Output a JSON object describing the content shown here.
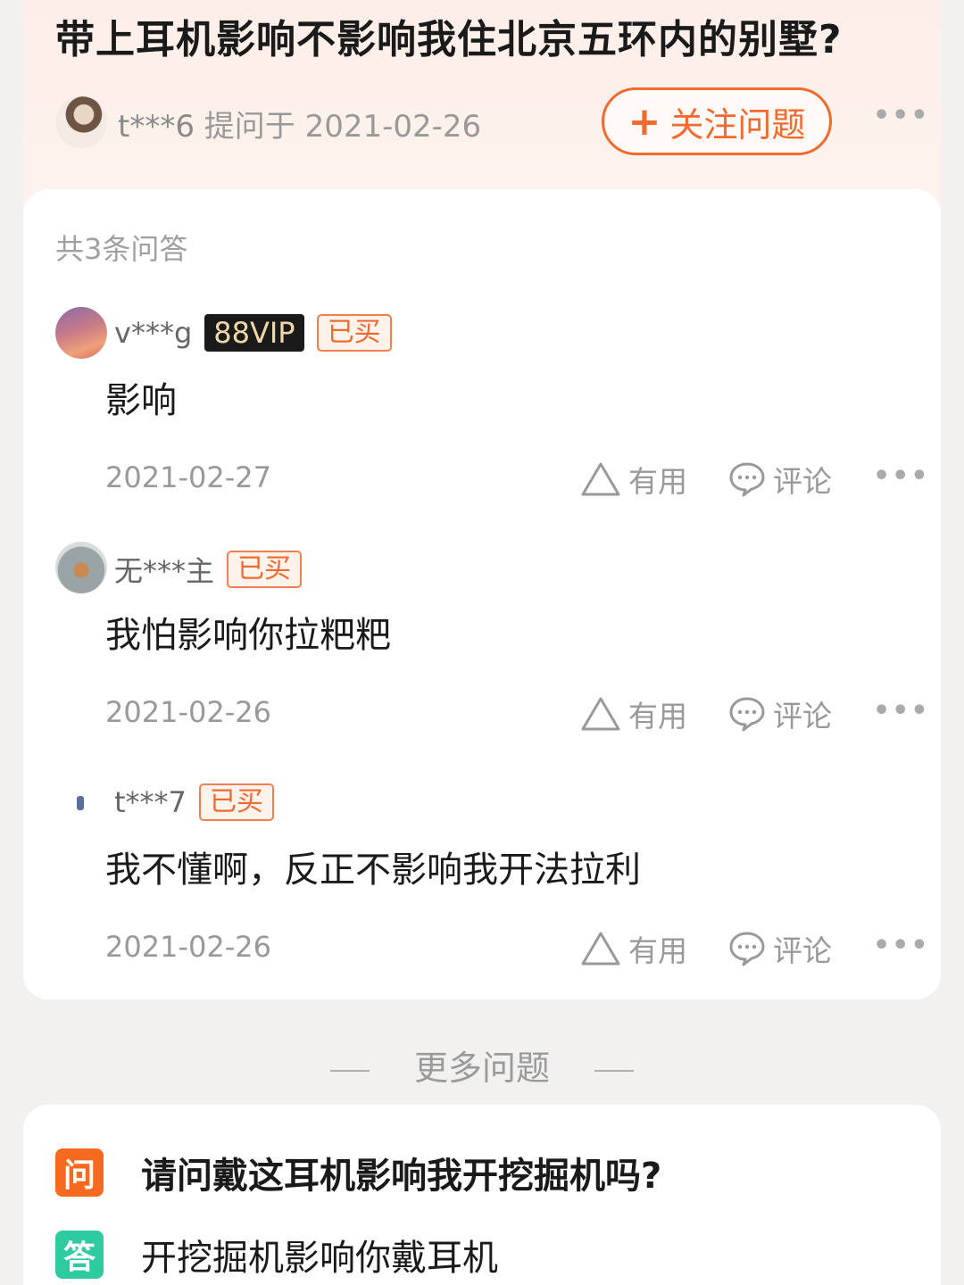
{
  "question": {
    "title": "带上耳机影响不影响我住北京五环内的别墅?",
    "asker": "t***6",
    "asked_label": "提问于 2021-02-26",
    "follow_label": "关注问题",
    "follow_plus": "+",
    "more": "•••"
  },
  "answers_section": {
    "count_label": "共3条问答",
    "useful_label": "有用",
    "comment_label": "评论",
    "more": "•••",
    "items": [
      {
        "user": "v***g",
        "vip": "88VIP",
        "bought": "已买",
        "text": "影响",
        "date": "2021-02-27"
      },
      {
        "user": "无***主",
        "bought": "已买",
        "text": "我怕影响你拉粑粑",
        "date": "2021-02-26"
      },
      {
        "user": "t***7",
        "bought": "已买",
        "text": "我不懂啊，反正不影响我开法拉利",
        "date": "2021-02-26"
      }
    ]
  },
  "more_questions": {
    "label": "更多问题",
    "item": {
      "q_icon": "问",
      "question": "请问戴这耳机影响我开挖掘机吗?",
      "a_icon": "答",
      "answer": "开挖掘机影响你戴耳机"
    }
  },
  "colors": {
    "accent": "#f26a2d",
    "header_bg": "#fdeee9",
    "answer_icon": "#2ecba0",
    "vip_bg": "#1a1a1a"
  },
  "icons": [
    "triangle-up-icon",
    "comment-bubble-icon",
    "more-dots-icon",
    "plus-icon"
  ]
}
